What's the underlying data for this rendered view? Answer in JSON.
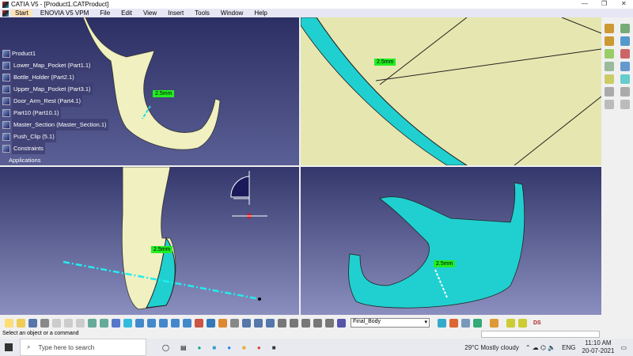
{
  "window": {
    "title": "CATIA V5 - [Product1.CATProduct]",
    "controls": [
      "—",
      "❐",
      "✕"
    ]
  },
  "menu": [
    "Start",
    "ENOVIA V5 VPM",
    "File",
    "Edit",
    "View",
    "Insert",
    "Tools",
    "Window",
    "Help"
  ],
  "tree": {
    "root": "Product1",
    "items": [
      "Lower_Map_Pocket (Part1.1)",
      "Bottle_Holder (Part2.1)",
      "Upper_Map_Pocket (Part3.1)",
      "Door_Arm_Rest (Part4.1)",
      "Part10 (Part10.1)",
      "Master_Section (Master_Section.1)",
      "Push_Clip (5.1)",
      "Constraints"
    ],
    "applications": "Applications"
  },
  "dimensions": {
    "v1": "2.5mm",
    "v2": "2.5mm",
    "v3": "2.5mm",
    "v4": "2.5mm"
  },
  "toolbar": {
    "body_select": "Final_Body"
  },
  "status": "Select an object or a command",
  "taskbar": {
    "search_placeholder": "Type here to search",
    "weather": "29°C  Mostly cloudy",
    "lang": "ENG",
    "time": "11:10 AM",
    "date": "20-07-2021"
  },
  "colors": {
    "part_yellow": "#f0f0c0",
    "part_cyan": "#20d0d0",
    "dim_green": "#22ee22"
  }
}
